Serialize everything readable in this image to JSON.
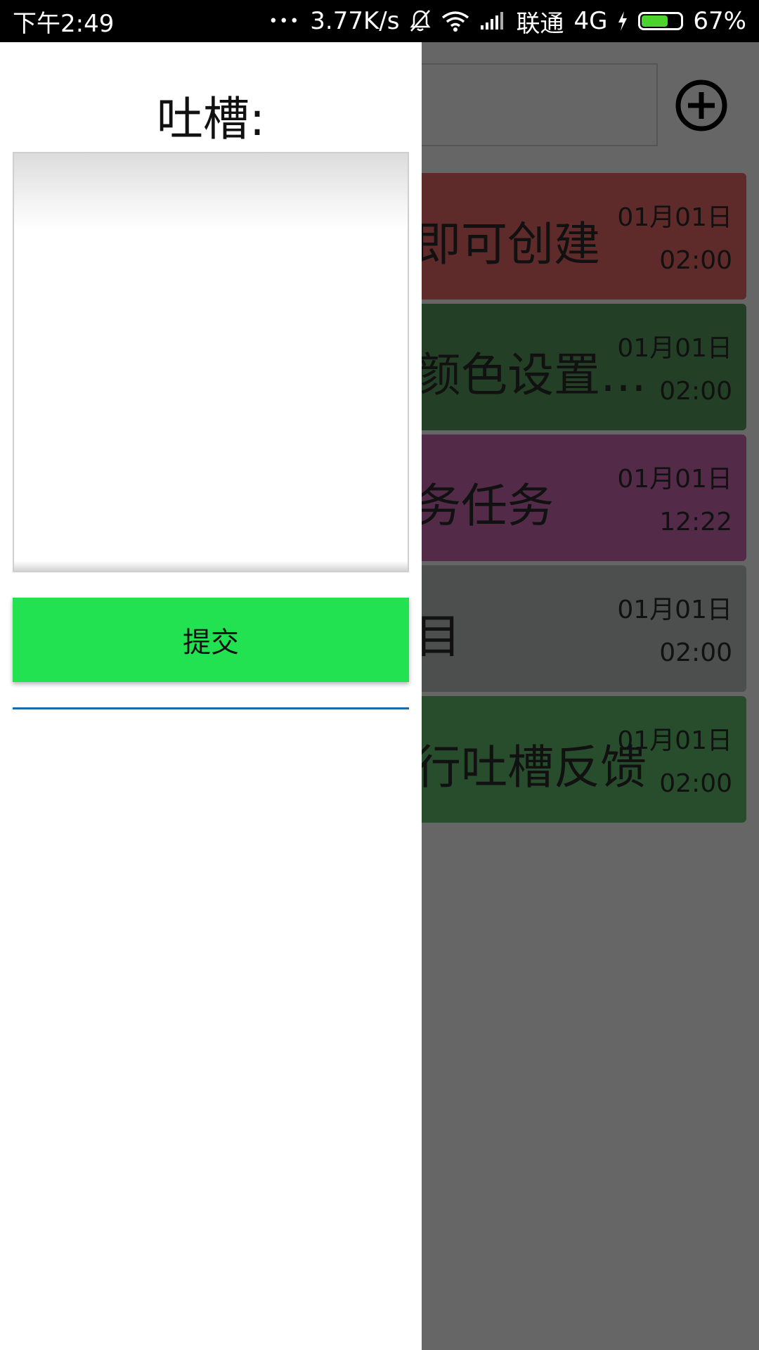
{
  "status_bar": {
    "time": "下午2:49",
    "dots": "•••",
    "speed": "3.77K/s",
    "carrier": "联通",
    "network": "4G",
    "battery_percent_text": "67%",
    "battery_level": 0.67,
    "battery_color": "#4cd32e"
  },
  "main": {
    "tasks": [
      {
        "title": "即可创建",
        "date": "01月01日",
        "time": "02:00",
        "color": "#5e2a2a"
      },
      {
        "title": "颜色设置…",
        "date": "01月01日",
        "time": "02:00",
        "color": "#233f26"
      },
      {
        "title": "务任务",
        "date": "01月01日",
        "time": "12:22",
        "color": "#532b48"
      },
      {
        "title": "目",
        "date": "01月01日",
        "time": "02:00",
        "color": "#4c4f4e"
      },
      {
        "title": "行吐槽反馈",
        "date": "01月01日",
        "time": "02:00",
        "color": "#284d2d"
      }
    ]
  },
  "drawer": {
    "title": "吐槽:",
    "input_value": "",
    "submit_label": "提交",
    "submit_color": "#22e252"
  }
}
